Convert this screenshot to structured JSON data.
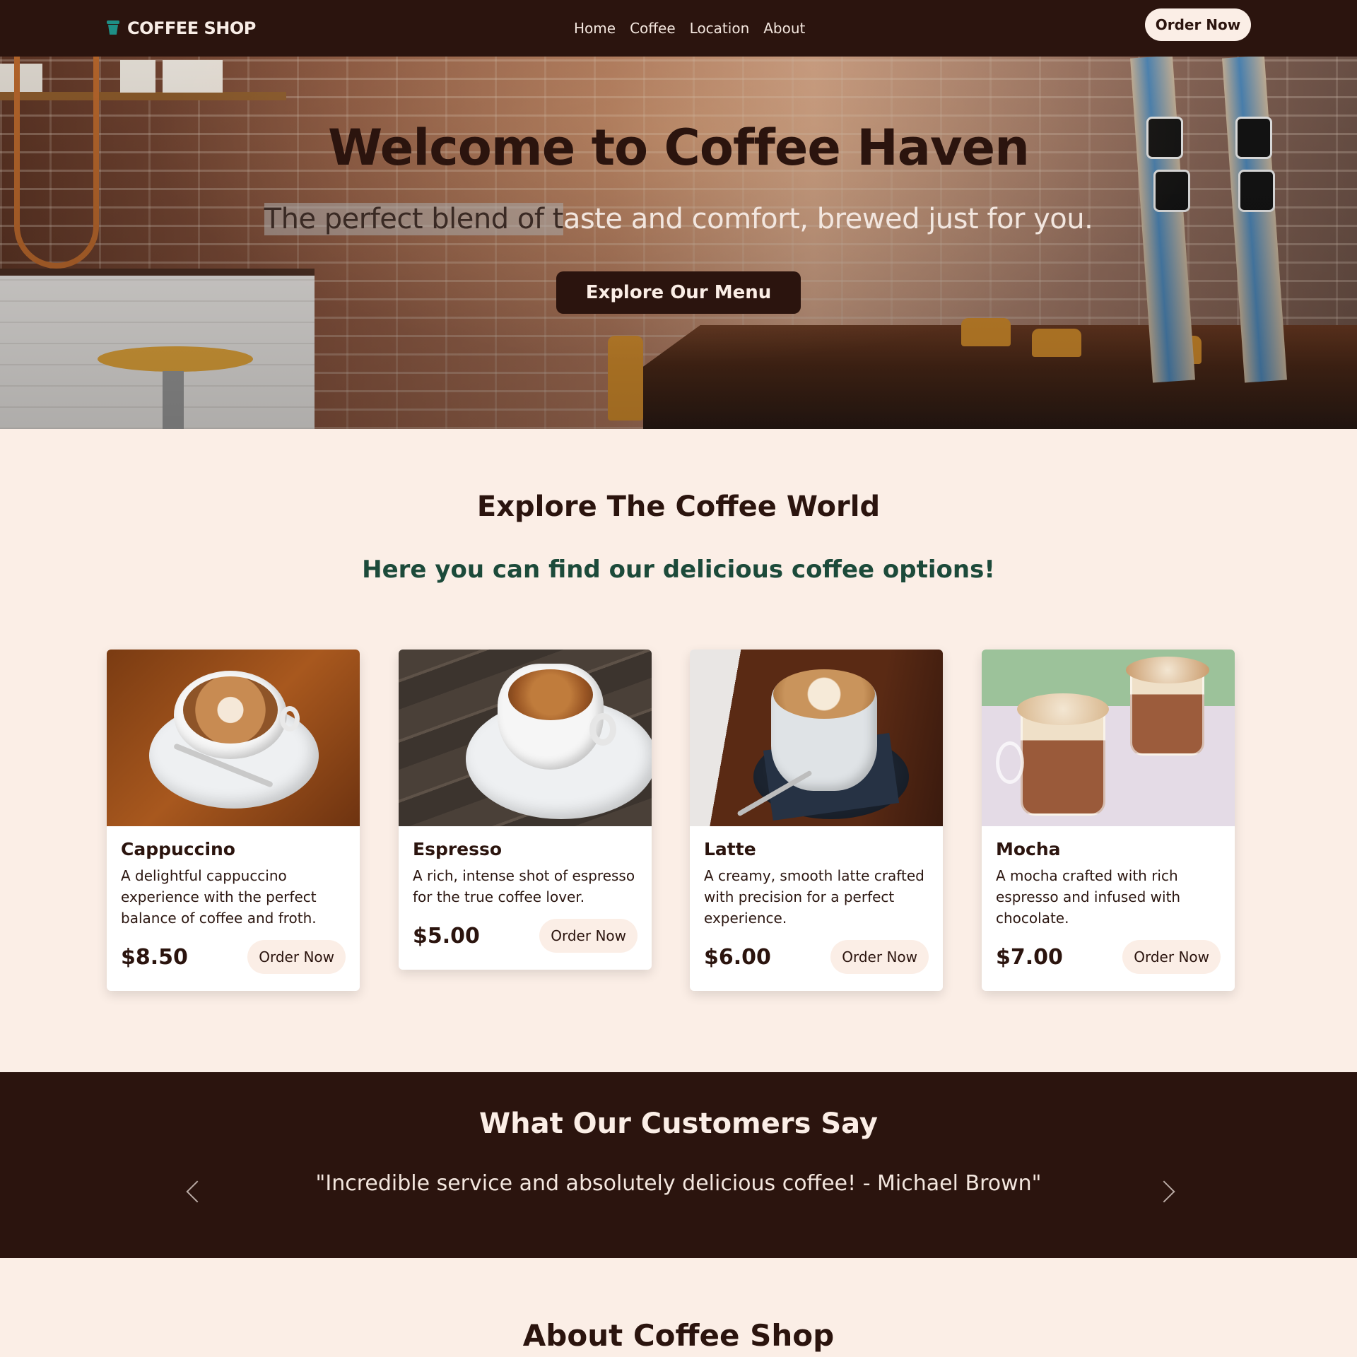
{
  "nav": {
    "brand": "COFFEE SHOP",
    "links": [
      "Home",
      "Coffee",
      "Location",
      "About"
    ],
    "cta": "Order Now"
  },
  "hero": {
    "title": "Welcome to Coffee Haven",
    "subtitle_highlighted": "The perfect blend of t",
    "subtitle_rest": "aste and comfort, brewed just for you.",
    "button": "Explore Our Menu"
  },
  "explore": {
    "title": "Explore The Coffee World",
    "subtitle": "Here you can find our delicious coffee options!"
  },
  "cards": [
    {
      "name": "Cappuccino",
      "desc": "A delightful cappuccino experience with the perfect balance of coffee and froth.",
      "price": "$8.50",
      "button": "Order Now"
    },
    {
      "name": "Espresso",
      "desc": "A rich, intense shot of espresso for the true coffee lover.",
      "price": "$5.00",
      "button": "Order Now"
    },
    {
      "name": "Latte",
      "desc": "A creamy, smooth latte crafted with precision for a perfect experience.",
      "price": "$6.00",
      "button": "Order Now"
    },
    {
      "name": "Mocha",
      "desc": "A mocha crafted with rich espresso and infused with chocolate.",
      "price": "$7.00",
      "button": "Order Now"
    }
  ],
  "testimonials": {
    "title": "What Our Customers Say",
    "quote": "\"Incredible service and absolutely delicious coffee! - Michael Brown\""
  },
  "about": {
    "title": "About Coffee Shop"
  },
  "colors": {
    "dark_brown": "#2b140e",
    "cream": "#fbeee6",
    "green_accent": "#1c4a3a",
    "brand_icon": "#1e8f86"
  },
  "icons": [
    "coffee-cup-icon",
    "chevron-left-icon",
    "chevron-right-icon"
  ]
}
